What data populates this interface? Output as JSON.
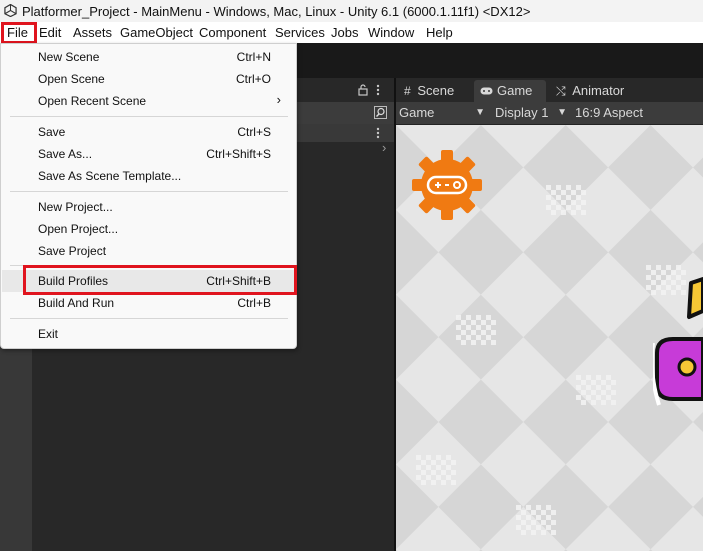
{
  "window": {
    "title": "Platformer_Project - MainMenu - Windows, Mac, Linux - Unity 6.1 (6000.1.11f1) <DX12>"
  },
  "menubar": {
    "items": [
      "File",
      "Edit",
      "Assets",
      "GameObject",
      "Component",
      "Services",
      "Jobs",
      "Window",
      "Help"
    ]
  },
  "file_menu": {
    "items": [
      {
        "label": "New Scene",
        "shortcut": "Ctrl+N"
      },
      {
        "label": "Open Scene",
        "shortcut": "Ctrl+O"
      },
      {
        "label": "Open Recent Scene",
        "shortcut": "",
        "submenu": "›"
      },
      {
        "label": "Save",
        "shortcut": "Ctrl+S"
      },
      {
        "label": "Save As...",
        "shortcut": "Ctrl+Shift+S"
      },
      {
        "label": "Save As Scene Template...",
        "shortcut": ""
      },
      {
        "label": "New Project...",
        "shortcut": ""
      },
      {
        "label": "Open Project...",
        "shortcut": ""
      },
      {
        "label": "Save Project",
        "shortcut": ""
      },
      {
        "label": "Build Profiles",
        "shortcut": "Ctrl+Shift+B"
      },
      {
        "label": "Build And Run",
        "shortcut": "Ctrl+B"
      },
      {
        "label": "Exit",
        "shortcut": ""
      }
    ]
  },
  "view_tabs": {
    "scene": "Scene",
    "game": "Game",
    "animator": "Animator"
  },
  "game_toolbar": {
    "view_mode": "Game",
    "display": "Display 1",
    "aspect": "16:9 Aspect"
  },
  "icons": {
    "lock": "lock-icon",
    "more": "kebab-menu-icon",
    "search": "search-icon",
    "scene": "grid-icon",
    "game": "gamepad-icon",
    "animator": "animator-icon"
  },
  "colors": {
    "highlight_box": "#e0141e",
    "gear": "#f07a12",
    "logo_purple": "#c73bd8",
    "logo_yellow": "#f6c735"
  }
}
